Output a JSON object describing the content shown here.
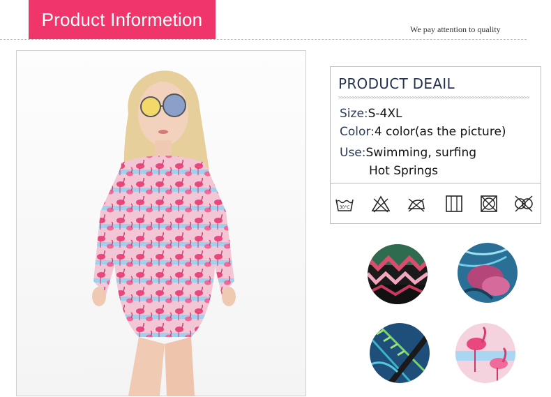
{
  "header": {
    "title": "Product Informetion",
    "tagline": "We pay attention to quality"
  },
  "details": {
    "title": "PRODUCT DEAIL",
    "arrows": ">>>>>>>>>>>>>>>>>>>>>>>>>>>>>>>>>>>>>>>>>>>>>>>>>>>>>>>>>>>>>>>>>>>>>>",
    "size_label": "Size:",
    "size_value": "S-4XL",
    "color_label": "Color:",
    "color_value": "4 color(as the picture)",
    "use_label": "Use:",
    "use_value": "Swimming, surfing",
    "use_value_2": "Hot Springs"
  },
  "care_icons": [
    "wash-30-icon",
    "no-bleach-icon",
    "no-iron-icon",
    "tumble-dry-icon",
    "no-tumble-dry-icon",
    "no-dry-clean-icon"
  ],
  "colors": {
    "header_accent": "#f0356b",
    "title_color": "#23334f"
  },
  "swatches": [
    "geometric-pattern",
    "tropical-leaf-pattern",
    "blue-fern-pattern",
    "flamingo-pattern"
  ],
  "care_text": {
    "wash_temp": "30°C"
  }
}
